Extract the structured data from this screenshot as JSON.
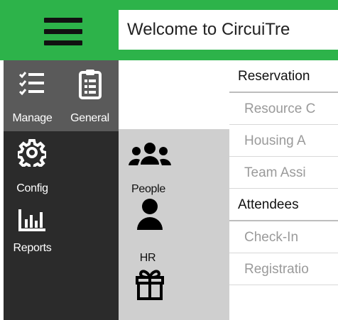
{
  "header": {
    "welcome": "Welcome to CircuiTre"
  },
  "rail": {
    "items": [
      {
        "label": "Manage",
        "icon": "checklist-icon"
      },
      {
        "label": "General",
        "icon": "clipboard-icon"
      },
      {
        "label": "Config",
        "icon": "gear-icon"
      },
      {
        "label": "People",
        "icon": "people-group-icon"
      },
      {
        "label": "Reports",
        "icon": "bar-chart-icon"
      },
      {
        "label": "HR",
        "icon": "person-icon"
      },
      {
        "label": "",
        "icon": "gift-icon"
      }
    ]
  },
  "menu": {
    "sections": [
      {
        "title": "Reservation",
        "items": [
          "Resource C",
          "Housing A",
          "Team Assi"
        ]
      },
      {
        "title": "Attendees",
        "items": [
          "Check-In",
          "Registratio"
        ]
      }
    ]
  },
  "colors": {
    "topbar": "#2db34a",
    "rail": "#2b2b2b",
    "rail_active": "#5a5a5a",
    "submenu_bg": "#cfcfcf"
  }
}
